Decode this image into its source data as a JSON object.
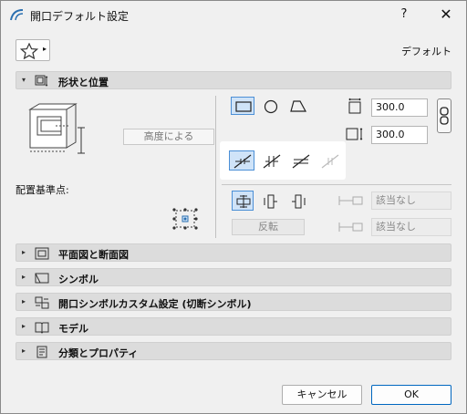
{
  "window": {
    "title": "開口デフォルト設定",
    "help": "?",
    "close": "✕"
  },
  "favorites": {
    "arrow": "▸"
  },
  "header": {
    "default_label": "デフォルト"
  },
  "sections": [
    {
      "label": "形状と位置",
      "expanded": true,
      "toggle": "▾",
      "icon": "window-dimensions-icon"
    },
    {
      "label": "平面図と断面図",
      "expanded": false,
      "toggle": "▸",
      "icon": "floor-plan-icon"
    },
    {
      "label": "シンボル",
      "expanded": false,
      "toggle": "▸",
      "icon": "symbol-icon"
    },
    {
      "label": "開口シンボルカスタム設定 (切断シンボル)",
      "expanded": false,
      "toggle": "▸",
      "icon": "custom-symbol-icon"
    },
    {
      "label": "モデル",
      "expanded": false,
      "toggle": "▸",
      "icon": "model-book-icon"
    },
    {
      "label": "分類とプロパティ",
      "expanded": false,
      "toggle": "▸",
      "icon": "properties-icon"
    }
  ],
  "geometry": {
    "height_button": "高度による",
    "anchor_label": "配置基準点:",
    "shapes": [
      "rectangle",
      "circle",
      "polygon"
    ],
    "selected_shape": "rectangle",
    "width_value": "300.0",
    "height_value": "300.0",
    "mirror_selected": 0,
    "orientation_selected": 0,
    "flip_button": "反転",
    "none_value_1": "該当なし",
    "none_value_2": "該当なし"
  },
  "footer": {
    "cancel": "キャンセル",
    "ok": "OK"
  }
}
